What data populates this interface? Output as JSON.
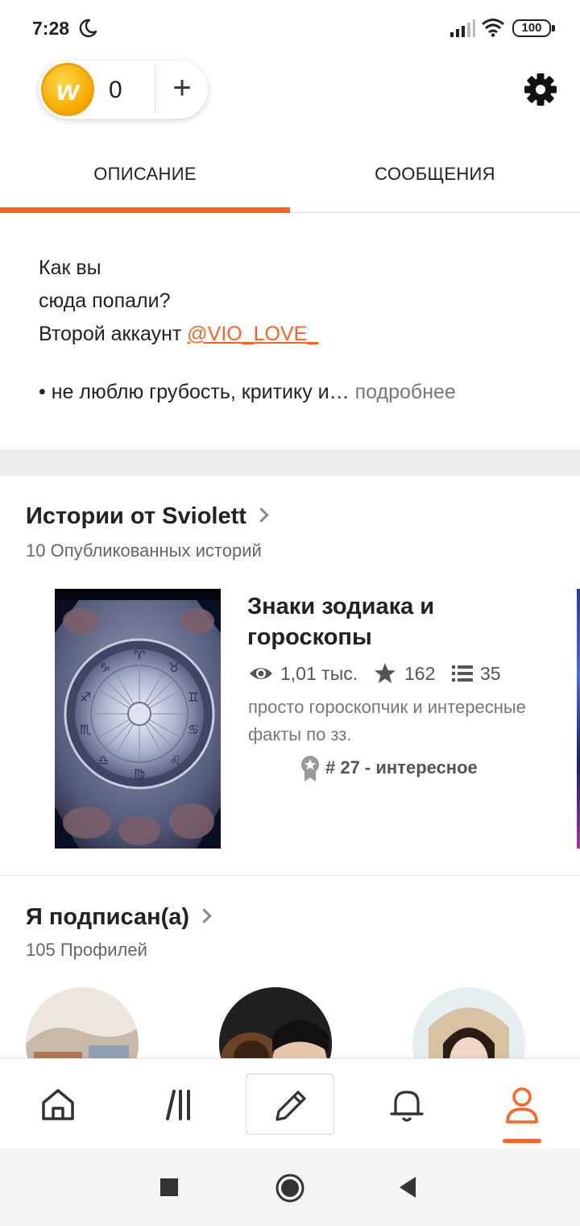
{
  "status_bar": {
    "time": "7:28",
    "battery": "100"
  },
  "wallet": {
    "coin_letter": "w",
    "coin_count": "0",
    "add_label": "+"
  },
  "tabs": [
    {
      "label": "ОПИСАНИЕ",
      "active": true
    },
    {
      "label": "СООБЩЕНИЯ",
      "active": false
    }
  ],
  "about": {
    "line1": "Как вы",
    "line2": "сюда попали?",
    "line3_prefix": "Второй аккаунт ",
    "mention": "@VIO_LOVE_",
    "bullet": "• не люблю грубость, критику и…",
    "more": "подробнее"
  },
  "stories_section": {
    "title": "Истории от Sviolett",
    "subtitle": "10 Опубликованных историй",
    "story": {
      "title": "Знаки зодиака и гороскопы",
      "reads": "1,01 тыс.",
      "votes": "162",
      "parts": "35",
      "description": "просто гороскопчик и интересные факты по зз.",
      "rank": "# 27 - интересное"
    }
  },
  "following_section": {
    "title": "Я подписан(а)",
    "subtitle": "105 Профилей"
  },
  "colors": {
    "accent": "#ff6122",
    "coin": "#f5a800"
  },
  "bottom_nav": [
    "home-icon",
    "library-icon",
    "write-icon",
    "notifications-icon",
    "profile-icon"
  ]
}
